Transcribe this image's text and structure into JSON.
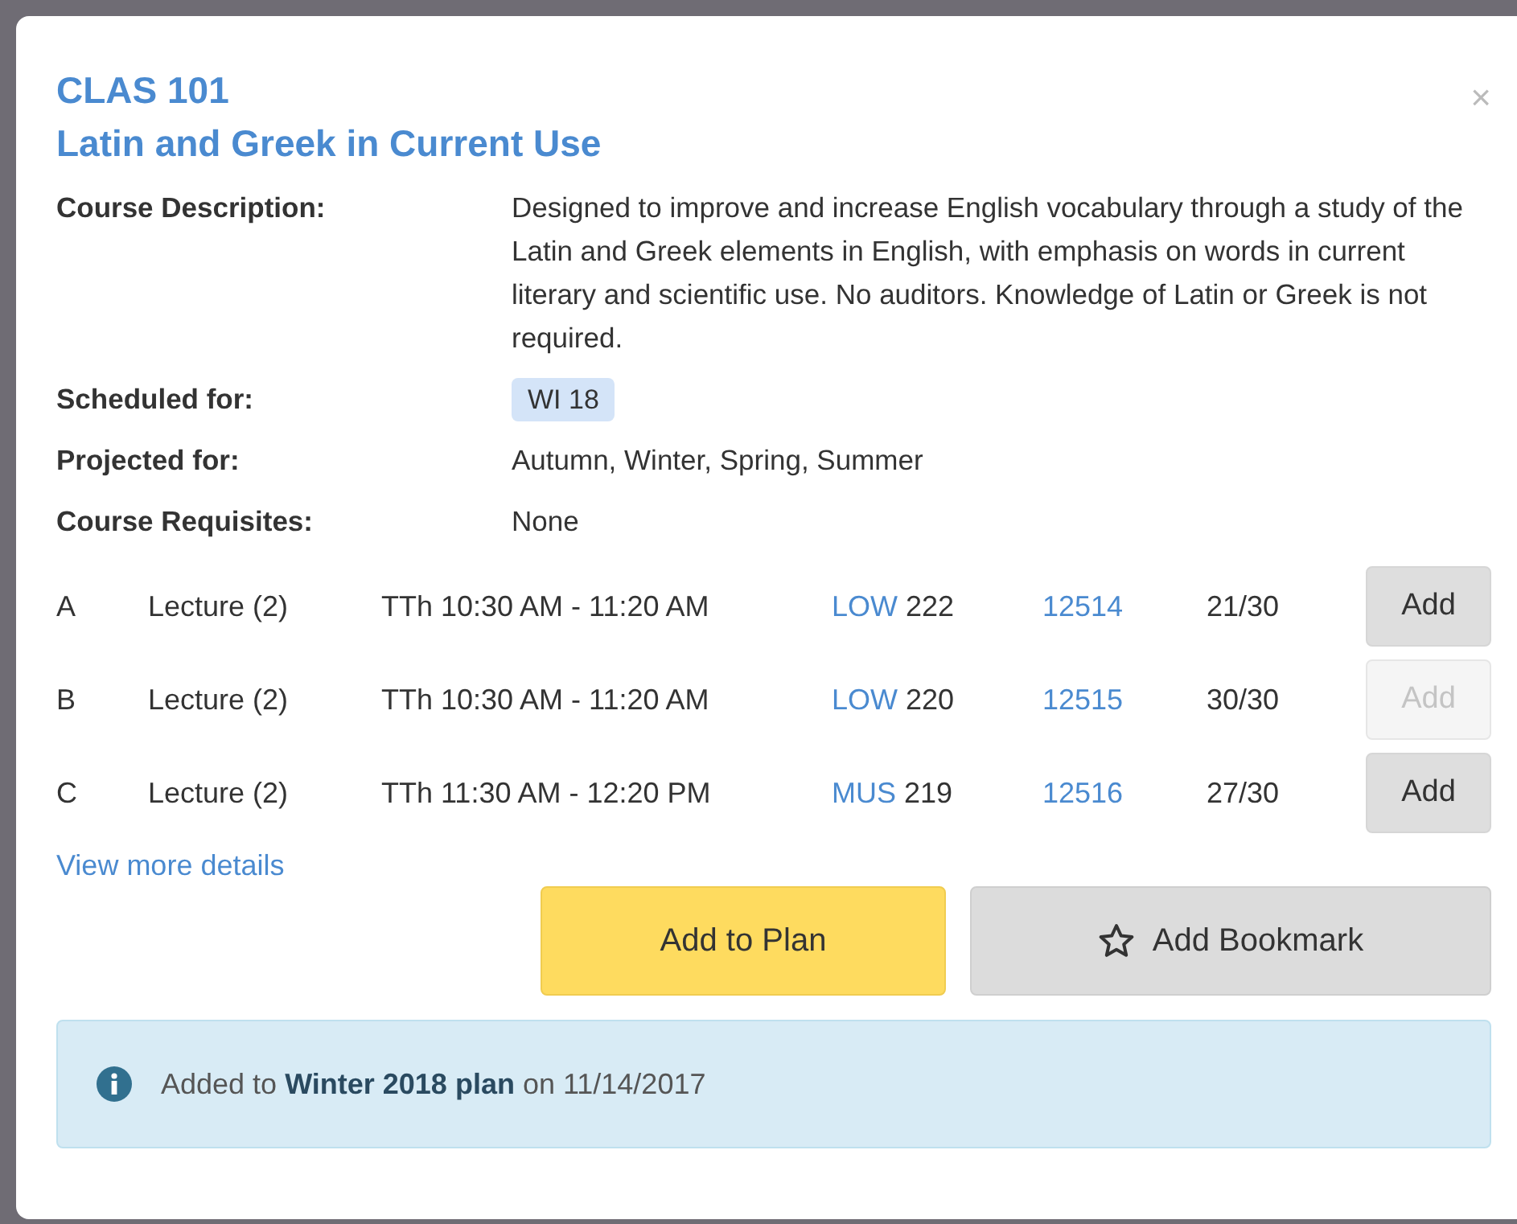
{
  "course": {
    "code": "CLAS 101",
    "title": "Latin and Greek in Current Use"
  },
  "close": "×",
  "details": [
    {
      "kind": "text",
      "label": "Course Description:",
      "value": "Designed to improve and increase English vocabulary through a study of the Latin and Greek elements in English, with emphasis on words in current literary and scientific use. No auditors. Knowledge of Latin or Greek is not required."
    },
    {
      "kind": "tag",
      "label": "Scheduled for:",
      "value": "WI 18"
    },
    {
      "kind": "text",
      "label": "Projected for:",
      "value": "Autumn, Winter, Spring, Summer"
    },
    {
      "kind": "text",
      "label": "Course Requisites:",
      "value": "None"
    }
  ],
  "sections": [
    {
      "id": "A",
      "type": "Lecture (2)",
      "time": "TTh 10:30 AM - 11:20 AM",
      "building": "LOW",
      "room": "222",
      "sln": "12514",
      "seats": "21/30",
      "button": "Add",
      "disabled": false
    },
    {
      "id": "B",
      "type": "Lecture (2)",
      "time": "TTh 10:30 AM - 11:20 AM",
      "building": "LOW",
      "room": "220",
      "sln": "12515",
      "seats": "30/30",
      "button": "Add",
      "disabled": true
    },
    {
      "id": "C",
      "type": "Lecture (2)",
      "time": "TTh 11:30 AM - 12:20 PM",
      "building": "MUS",
      "room": "219",
      "sln": "12516",
      "seats": "27/30",
      "button": "Add",
      "disabled": false
    }
  ],
  "more_link": "View more details",
  "actions": {
    "plan": "Add to Plan",
    "bookmark": "Add Bookmark"
  },
  "notice": "Added to **Winter 2018 plan** on 11/14/2017"
}
